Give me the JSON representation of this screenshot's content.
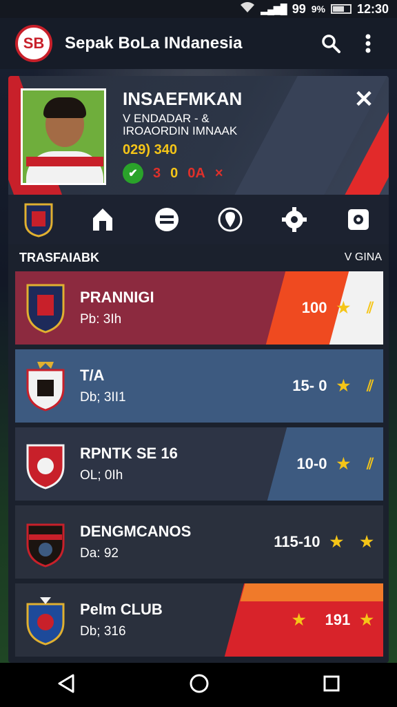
{
  "status": {
    "signal": "99",
    "battery": "9%",
    "time": "12:30"
  },
  "app": {
    "logo_text": "SB",
    "title": "Sepak BoLa INdanesia"
  },
  "profile": {
    "name": "INSAEFMKAN",
    "sub1": "V ENDADAR - &",
    "sub2": "IROAORDIN IMNAAK",
    "score": "029) 340",
    "stat_red": "3",
    "stat_yellow": "0",
    "stat_code": "0A",
    "stat_x": "×",
    "close": "✕"
  },
  "section": {
    "left": "TRASFAIABK",
    "right": "V GINA"
  },
  "clubs": [
    {
      "name": "PRANNIGI",
      "sub": "Pb: 3Ih",
      "score": "100",
      "colors": {
        "bg": "#8c2a3f",
        "accent": "#ef4a20",
        "accent2": "#f2f2f2"
      }
    },
    {
      "name": "T/A",
      "sub": "Db; 3II1",
      "score": "15- 0",
      "colors": {
        "bg": "#3d5a80"
      }
    },
    {
      "name": "RPNTK SE 16",
      "sub": "OL; 0Ih",
      "score": "10-0",
      "colors": {
        "bg": "#2d3445",
        "accent": "#3d5a80"
      }
    },
    {
      "name": "DENGMCANOS",
      "sub": "Da: 92",
      "score": "115-10",
      "colors": {
        "bg": "#2a303d"
      }
    },
    {
      "name": "Pelm CLUB",
      "sub": "Db; 316",
      "score": "191",
      "colors": {
        "bg": "#2a303d",
        "accent": "#d8232a",
        "accent2": "#f07a2a"
      }
    }
  ]
}
